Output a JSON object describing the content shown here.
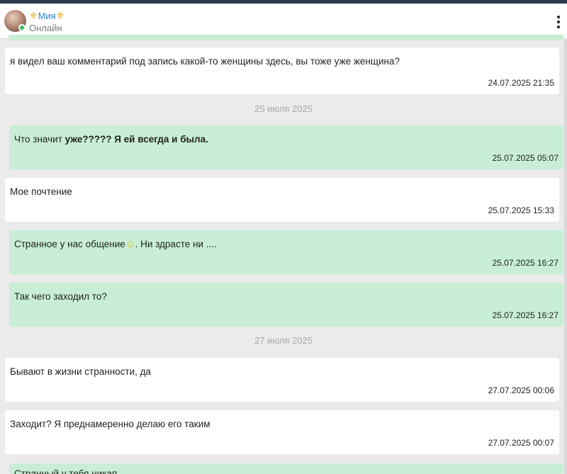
{
  "header": {
    "ornament_left": "⚜",
    "contact_name": "Мия",
    "ornament_right": "⚜",
    "status": "Онлайн"
  },
  "colors": {
    "outgoing_bubble": "#c8eed5",
    "incoming_bubble": "#ffffff",
    "background": "#ebebeb",
    "name_color": "#2a7fd4",
    "online_dot": "#2fbf52"
  },
  "icons": {
    "menu": "vertical-dots-icon",
    "status": "online-dot-icon"
  },
  "messages": [
    {
      "dir": "in",
      "text": "я видел ваш комментарий под запись какой-то женщины здесь, вы тоже уже женщина?",
      "time": "24.07.2025 21:35"
    },
    {
      "date": "25 июля 2025"
    },
    {
      "dir": "out",
      "text_a": "Что значит ",
      "text_b": "уже????? Я ей всегда и была.",
      "time": "25.07.2025 05:07"
    },
    {
      "dir": "in",
      "text": "Мое почтение",
      "time": "25.07.2025 15:33"
    },
    {
      "dir": "out",
      "text_a": "Странное у нас общение",
      "emoji": "☺",
      "text_b": ". Ни здрасте ни ....",
      "time": "25.07.2025 16:27"
    },
    {
      "dir": "out",
      "text": "Так чего заходил то?",
      "time": "25.07.2025 16:27"
    },
    {
      "date": "27 июля 2025"
    },
    {
      "dir": "in",
      "text": "Бывают в жизни странности, да",
      "time": "27.07.2025 00:06"
    },
    {
      "dir": "in",
      "text": "Заходит? Я преднамеренно делаю его таким",
      "time": "27.07.2025 00:07"
    },
    {
      "dir": "out",
      "text": "Странный у тебя никап",
      "time": ""
    }
  ]
}
